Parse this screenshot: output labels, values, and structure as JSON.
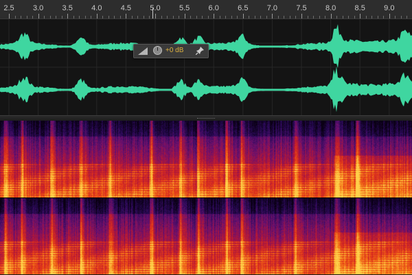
{
  "timeline": {
    "ruler_labels": [
      "2.5",
      "3.0",
      "3.5",
      "4.0",
      "4.5",
      "5.0",
      "5.5",
      "6.0",
      "6.5",
      "7.0",
      "7.5",
      "8.0",
      "8.5",
      "9.0"
    ],
    "playhead_seconds": 4.95
  },
  "hud": {
    "volume_value": "+0 dB",
    "icons": [
      "ramp-icon",
      "volume-knob-icon",
      "pin-icon"
    ]
  },
  "waveform": {
    "channels": [
      "top-channel",
      "bottom-channel"
    ],
    "color": "#3fd6a0"
  },
  "spectral": {
    "channels": [
      "top-channel",
      "bottom-channel"
    ],
    "palette": [
      "#0a0014",
      "#2a0a5a",
      "#6a1070",
      "#b0163a",
      "#e0321a",
      "#f57a18",
      "#ffd24a"
    ]
  },
  "colors": {
    "ruler_bg": "#2d2d2d",
    "waveform_bg": "#141414",
    "hud_value": "#e0b340"
  }
}
